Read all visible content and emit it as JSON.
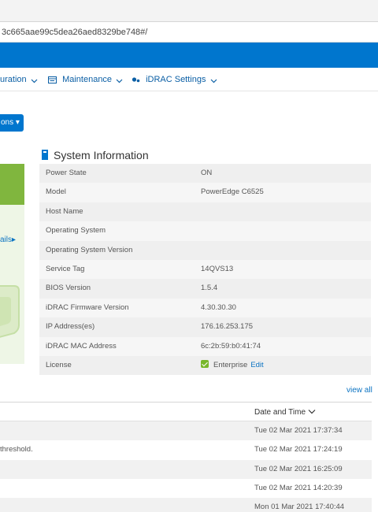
{
  "browser": {
    "url": "3c665aae99c5dea26aed8329be748#/"
  },
  "nav": {
    "items": [
      {
        "label": "uration",
        "icon": "none"
      },
      {
        "label": "Maintenance",
        "icon": "maintenance-icon"
      },
      {
        "label": "iDRAC Settings",
        "icon": "idrac-settings-icon"
      }
    ]
  },
  "actions": {
    "label": "ons"
  },
  "left_panel": {
    "details_link": "ails"
  },
  "system_info": {
    "title": "System Information",
    "rows": [
      {
        "label": "Power State",
        "value": "ON"
      },
      {
        "label": "Model",
        "value": "PowerEdge C6525"
      },
      {
        "label": "Host Name",
        "value": ""
      },
      {
        "label": "Operating System",
        "value": ""
      },
      {
        "label": "Operating System Version",
        "value": ""
      },
      {
        "label": "Service Tag",
        "value": "14QVS13"
      },
      {
        "label": "BIOS Version",
        "value": "1.5.4"
      },
      {
        "label": "iDRAC Firmware Version",
        "value": "4.30.30.30"
      },
      {
        "label": "IP Address(es)",
        "value": "176.16.253.175"
      },
      {
        "label": "iDRAC MAC Address",
        "value": "6c:2b:59:b0:41:74"
      },
      {
        "label": "License",
        "value": "Enterprise"
      }
    ],
    "license_edit": "Edit"
  },
  "logs": {
    "view_all": "view all",
    "date_header": "Date and Time",
    "rows": [
      {
        "message": "",
        "date": "Tue 02 Mar 2021 17:37:34"
      },
      {
        "message": " threshold.",
        "date": "Tue 02 Mar 2021 17:24:19"
      },
      {
        "message": "",
        "date": "Tue 02 Mar 2021 16:25:09"
      },
      {
        "message": "",
        "date": "Tue 02 Mar 2021 14:20:39"
      },
      {
        "message": "",
        "date": "Mon 01 Mar 2021 17:40:44"
      }
    ]
  },
  "colors": {
    "brand_blue": "#0076ce",
    "status_green": "#80b63e",
    "link_blue": "#0b73c2"
  }
}
